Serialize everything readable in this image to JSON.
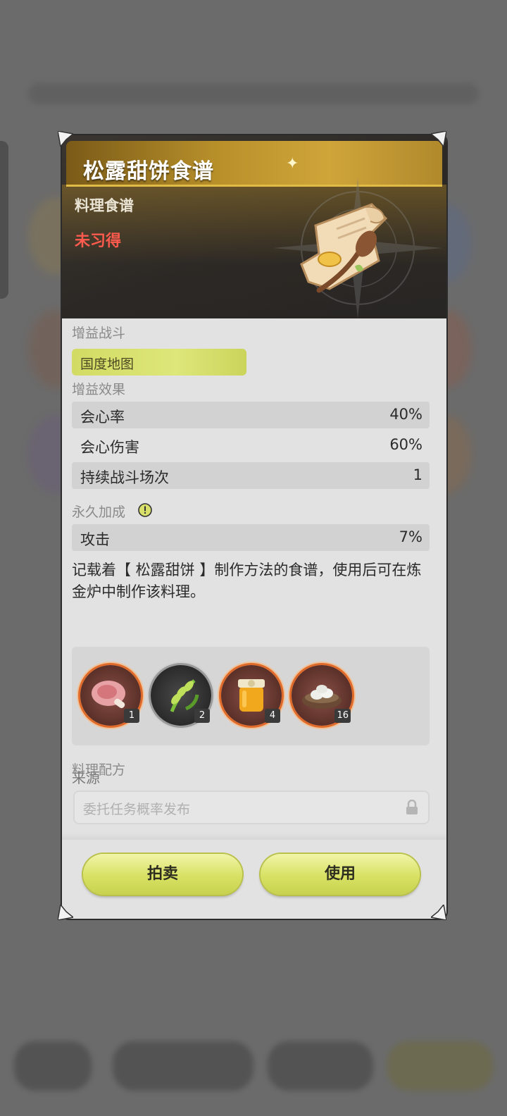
{
  "item": {
    "title": "松露甜饼食谱",
    "subtype": "料理食谱",
    "status": "未习得"
  },
  "buff_battle": {
    "label": "增益战斗",
    "tag": "国度地图"
  },
  "buff_effects": {
    "label": "增益效果",
    "rows": [
      {
        "name": "会心率",
        "value": "40%"
      },
      {
        "name": "会心伤害",
        "value": "60%"
      },
      {
        "name": "持续战斗场次",
        "value": "1"
      }
    ]
  },
  "permanent_bonus": {
    "label": "永久加成",
    "rows": [
      {
        "name": "攻击",
        "value": "7%"
      }
    ]
  },
  "description": "记载着【 松露甜饼 】制作方法的食谱，使用后可在炼金炉中制作该料理。",
  "recipe": {
    "label": "料理配方",
    "ingredients": [
      {
        "icon": "meat-icon",
        "count": "1",
        "ring": "#e06a2a"
      },
      {
        "icon": "herb-icon",
        "count": "2",
        "ring": "#9a9a9a"
      },
      {
        "icon": "honey-jar-icon",
        "count": "4",
        "ring": "#e06a2a"
      },
      {
        "icon": "dumpling-bowl-icon",
        "count": "16",
        "ring": "#e06a2a"
      }
    ]
  },
  "source": {
    "label": "来源",
    "value": "委托任务概率发布"
  },
  "buttons": {
    "auction": "拍卖",
    "use": "使用"
  },
  "colors": {
    "status_red": "#ff5a4e",
    "button_yellow": "#d8e163",
    "title_gold": "#cfa53a"
  }
}
